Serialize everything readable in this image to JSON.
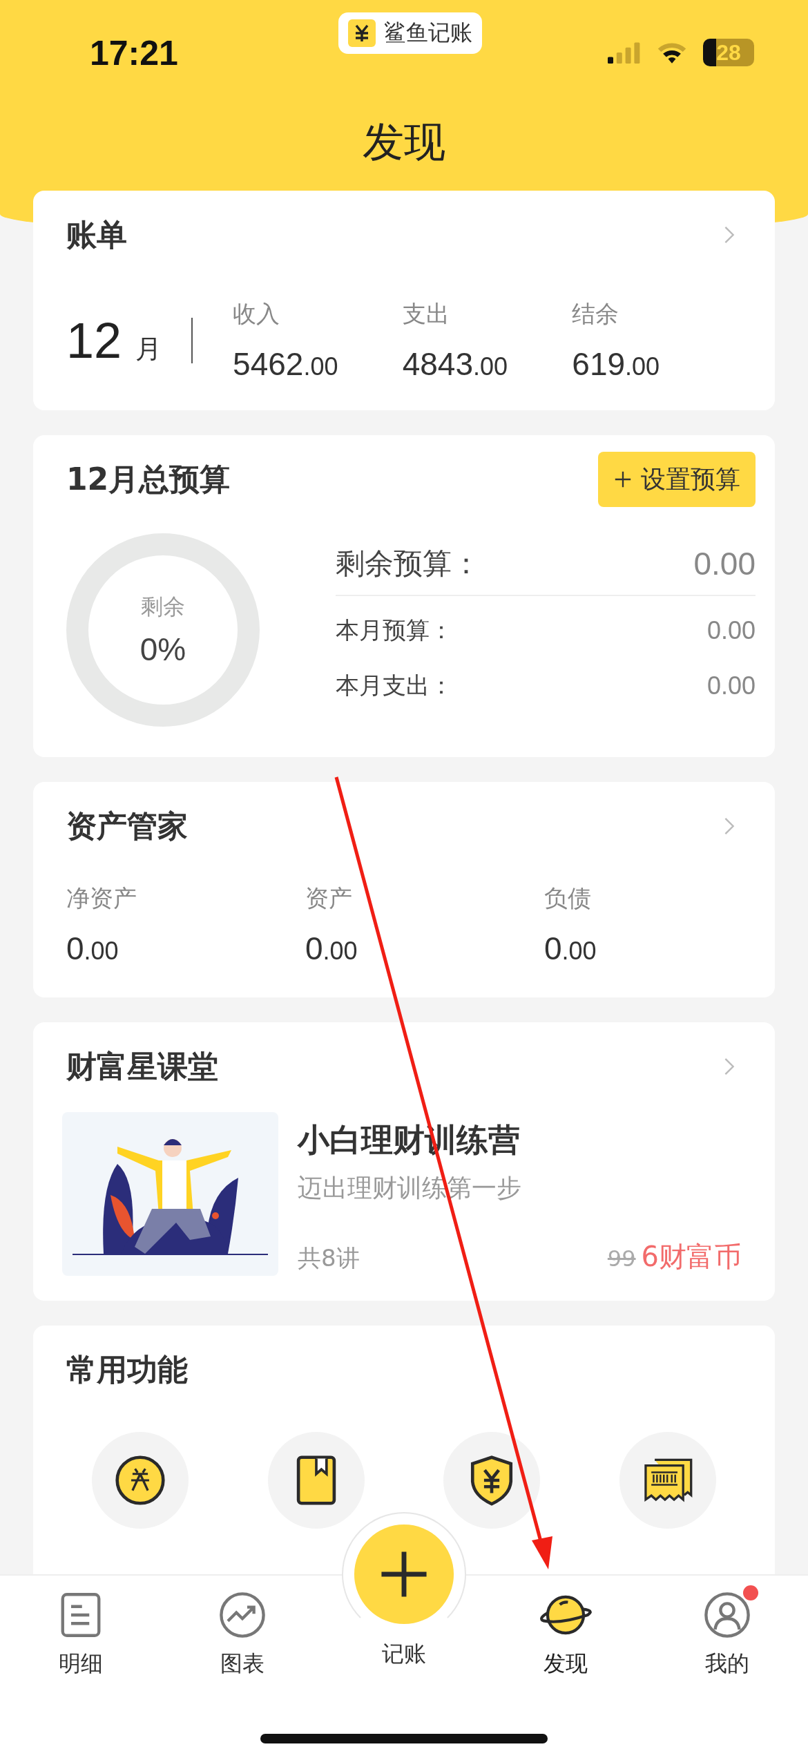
{
  "status_bar": {
    "time": "17:21",
    "app_badge": "鲨鱼记账",
    "battery": "28"
  },
  "header": {
    "title": "发现"
  },
  "bill": {
    "title": "账单",
    "month": "12",
    "month_unit": "月",
    "stats": [
      {
        "label": "收入",
        "value": "5462",
        "decimals": ".00"
      },
      {
        "label": "支出",
        "value": "4843",
        "decimals": ".00"
      },
      {
        "label": "结余",
        "value": "619",
        "decimals": ".00"
      }
    ]
  },
  "budget": {
    "title": "12月总预算",
    "button": "设置预算",
    "ring": {
      "label": "剩余",
      "value": "0%",
      "level": 0
    },
    "rows": [
      {
        "label": "剩余预算：",
        "value": "0.00",
        "kind": "primary"
      },
      {
        "label": "本月预算：",
        "value": "0.00",
        "kind": "secondary"
      },
      {
        "label": "本月支出：",
        "value": "0.00",
        "kind": "secondary"
      }
    ]
  },
  "assets": {
    "title": "资产管家",
    "stats": [
      {
        "label": "净资产",
        "value": "0",
        "decimals": ".00"
      },
      {
        "label": "资产",
        "value": "0",
        "decimals": ".00"
      },
      {
        "label": "负债",
        "value": "0",
        "decimals": ".00"
      }
    ]
  },
  "classroom": {
    "title": "财富星课堂",
    "course": {
      "title": "小白理财训练营",
      "subtitle": "迈出理财训练第一步",
      "lessons": "共8讲",
      "old_price": "99",
      "price": "6财富币"
    }
  },
  "functions": {
    "title": "常用功能",
    "items": [
      {
        "kind": "coupon"
      },
      {
        "kind": "book"
      },
      {
        "kind": "shield"
      },
      {
        "kind": "invoice"
      }
    ]
  },
  "tab_bar": {
    "items": [
      {
        "label": "明细",
        "kind": "list",
        "selected": false,
        "dot": false
      },
      {
        "label": "图表",
        "kind": "chart",
        "selected": false,
        "dot": false
      },
      {
        "label": "记账",
        "kind": "add",
        "selected": false,
        "dot": false
      },
      {
        "label": "发现",
        "kind": "planet",
        "selected": true,
        "dot": false
      },
      {
        "label": "我的",
        "kind": "user",
        "selected": false,
        "dot": true
      }
    ]
  }
}
